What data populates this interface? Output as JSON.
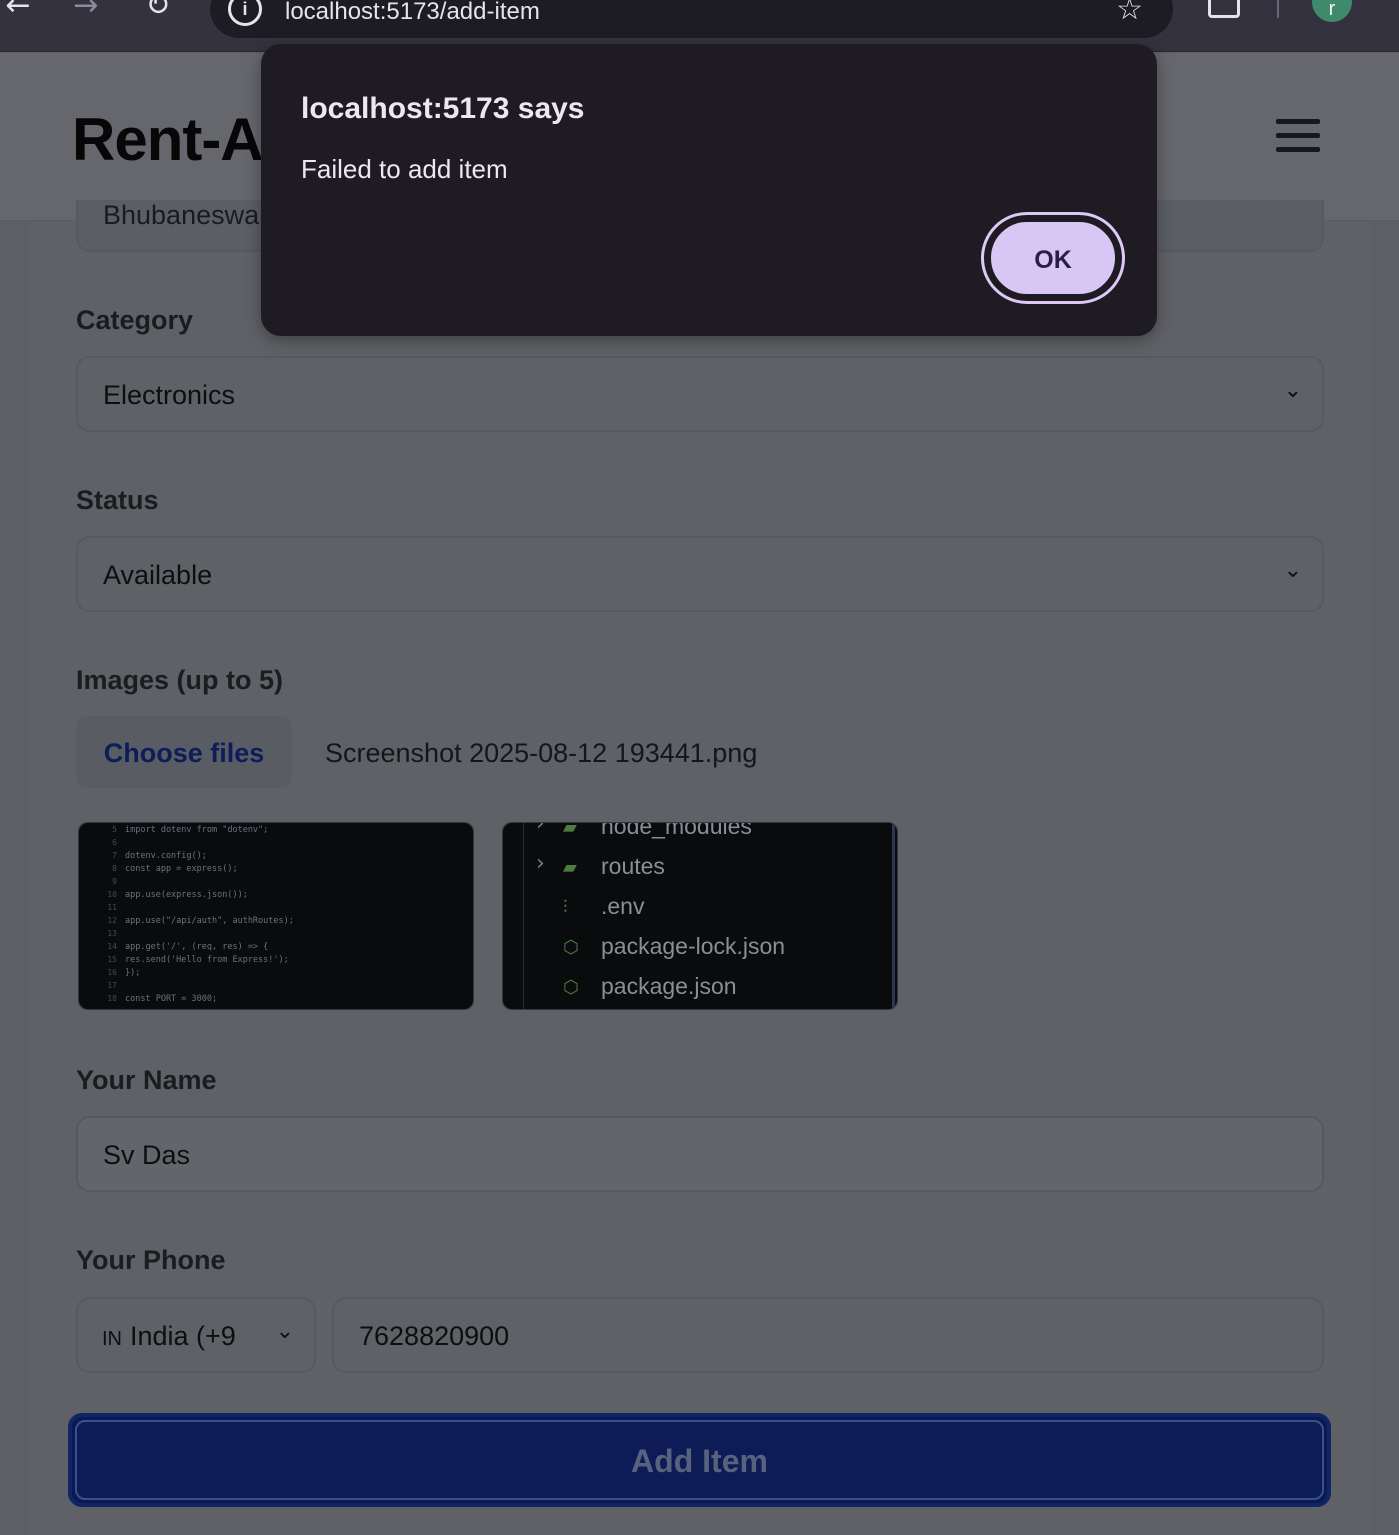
{
  "browser": {
    "url": "localhost:5173/add-item",
    "profile_initial": "r"
  },
  "header": {
    "brand": "Rent-A"
  },
  "form": {
    "location_partial_value": "Bhubaneswa",
    "category": {
      "label": "Category",
      "value": "Electronics"
    },
    "status": {
      "label": "Status",
      "value": "Available"
    },
    "images": {
      "label": "Images (up to 5)",
      "choose_button": "Choose files",
      "file_name": "Screenshot 2025-08-12 193441.png",
      "thumb1_lines": [
        {
          "n": "5",
          "code": "import dotenv from \"dotenv\";"
        },
        {
          "n": "6",
          "code": ""
        },
        {
          "n": "7",
          "code": "dotenv.config();"
        },
        {
          "n": "8",
          "code": "const app = express();"
        },
        {
          "n": "9",
          "code": ""
        },
        {
          "n": "10",
          "code": "app.use(express.json());"
        },
        {
          "n": "11",
          "code": ""
        },
        {
          "n": "12",
          "code": "app.use(\"/api/auth\", authRoutes);"
        },
        {
          "n": "13",
          "code": ""
        },
        {
          "n": "14",
          "code": "app.get('/', (req, res) => {"
        },
        {
          "n": "15",
          "code": "    res.send('Hello from Express!');"
        },
        {
          "n": "16",
          "code": "});"
        },
        {
          "n": "17",
          "code": ""
        },
        {
          "n": "18",
          "code": "const PORT = 3000;"
        }
      ],
      "thumb2_items": [
        "node_modules",
        "routes",
        ".env",
        "package-lock.json",
        "package.json"
      ]
    },
    "name": {
      "label": "Your Name",
      "value": "Sv Das"
    },
    "phone": {
      "label": "Your Phone",
      "country_code": "IN",
      "country_label": "India (+9",
      "number": "7628820900"
    },
    "submit_label": "Add Item"
  },
  "alert": {
    "title": "localhost:5173 says",
    "message": "Failed to add item",
    "ok_label": "OK"
  }
}
